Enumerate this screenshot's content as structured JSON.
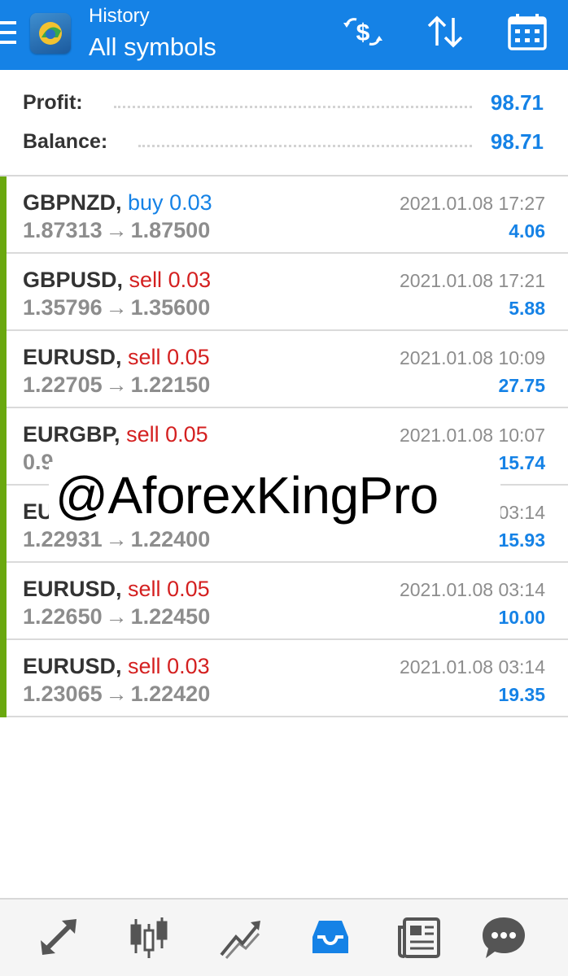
{
  "header": {
    "subtitle": "History",
    "title": "All symbols",
    "colors": {
      "bar": "#1582e6",
      "text": "#ffffff"
    },
    "icons": [
      "menu-icon",
      "app-logo",
      "currency-exchange-icon",
      "sort-icon",
      "calendar-icon"
    ]
  },
  "summary": {
    "profit_label": "Profit:",
    "profit_value": "98.71",
    "balance_label": "Balance:",
    "balance_value": "98.71"
  },
  "deals": [
    {
      "symbol": "GBPNZD,",
      "side": "buy",
      "volume": "0.03",
      "open": "1.87313",
      "close": "1.87500",
      "time": "2021.01.08 17:27",
      "profit": "4.06"
    },
    {
      "symbol": "GBPUSD,",
      "side": "sell",
      "volume": "0.03",
      "open": "1.35796",
      "close": "1.35600",
      "time": "2021.01.08 17:21",
      "profit": "5.88"
    },
    {
      "symbol": "EURUSD,",
      "side": "sell",
      "volume": "0.05",
      "open": "1.22705",
      "close": "1.22150",
      "time": "2021.01.08 10:09",
      "profit": "27.75"
    },
    {
      "symbol": "EURGBP,",
      "side": "sell",
      "volume": "0.05",
      "open": "0.9",
      "close": "",
      "time": "2021.01.08 10:07",
      "profit": "15.74"
    },
    {
      "symbol": "EU",
      "side": "",
      "volume": "",
      "open": "1.22931",
      "close": "1.22400",
      "time": "03:14",
      "profit": "15.93"
    },
    {
      "symbol": "EURUSD,",
      "side": "sell",
      "volume": "0.05",
      "open": "1.22650",
      "close": "1.22450",
      "time": "2021.01.08 03:14",
      "profit": "10.00"
    },
    {
      "symbol": "EURUSD,",
      "side": "sell",
      "volume": "0.03",
      "open": "1.23065",
      "close": "1.22420",
      "time": "2021.01.08 03:14",
      "profit": "19.35"
    }
  ],
  "arrow_glyph": "→",
  "colors": {
    "profit": "#1582e6",
    "buy": "#1582e6",
    "sell": "#d42020",
    "row_marker": "#6aa80f",
    "muted": "#8d8d8d"
  },
  "watermark": {
    "text": "@AforexKingPro"
  },
  "bottom_nav": {
    "items": [
      {
        "name": "quotes",
        "icon": "quotes-arrows-icon",
        "active": false
      },
      {
        "name": "chart",
        "icon": "candlestick-icon",
        "active": false
      },
      {
        "name": "trade",
        "icon": "trade-trend-icon",
        "active": false
      },
      {
        "name": "history",
        "icon": "history-inbox-icon",
        "active": true
      },
      {
        "name": "news",
        "icon": "news-icon",
        "active": false
      },
      {
        "name": "messages",
        "icon": "chat-bubble-icon",
        "active": false
      }
    ],
    "active_color": "#1582e6",
    "inactive_color": "#555555"
  }
}
